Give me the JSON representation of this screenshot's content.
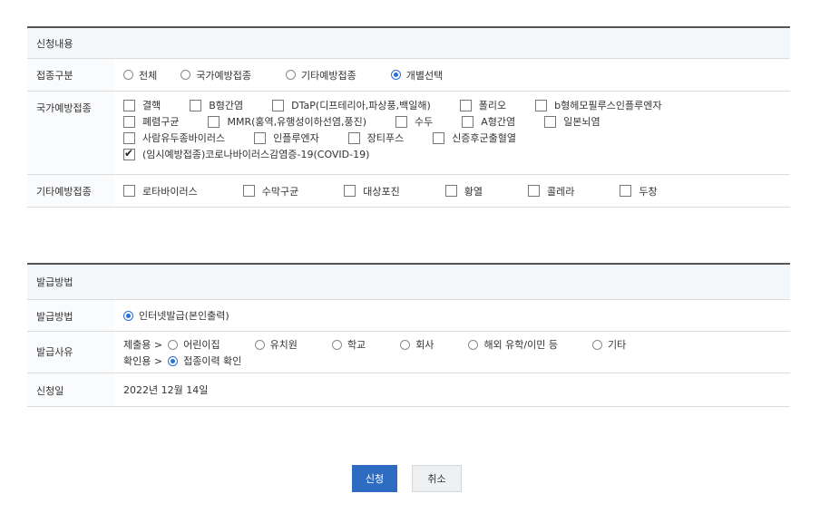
{
  "section1": {
    "title": "신청내용",
    "vaccine_type": {
      "label": "접종구분",
      "options": [
        "전체",
        "국가예방접종",
        "기타예방접종",
        "개별선택"
      ],
      "selected": "개별선택"
    },
    "national": {
      "label": "국가예방접종",
      "items": [
        "결핵",
        "B형간염",
        "DTaP(디프테리아,파상풍,백일해)",
        "폴리오",
        "b형헤모필루스인플루엔자",
        "폐렴구균",
        "MMR(홍역,유행성이하선염,풍진)",
        "수두",
        "A형간염",
        "일본뇌염",
        "사람유두종바이러스",
        "인플루엔자",
        "장티푸스",
        "신증후군출혈열",
        "(임시예방접종)코로나바이러스감염증-19(COVID-19)"
      ],
      "checked": [
        "(임시예방접종)코로나바이러스감염증-19(COVID-19)"
      ]
    },
    "other": {
      "label": "기타예방접종",
      "items": [
        "로타바이러스",
        "수막구균",
        "대상포진",
        "황열",
        "콜레라",
        "두창"
      ]
    }
  },
  "section2": {
    "title": "발급방법",
    "method": {
      "label": "발급방법",
      "option": "인터넷발급(본인출력)"
    },
    "reason": {
      "label": "발급사유",
      "submit_prefix": "제출용 >",
      "submit_options": [
        "어린이집",
        "유치원",
        "학교",
        "회사",
        "해외 유학/이민 등",
        "기타"
      ],
      "confirm_prefix": "확인용 >",
      "confirm_option": "접종이력 확인"
    },
    "date": {
      "label": "신청일",
      "value": "2022년 12월 14일"
    }
  },
  "buttons": {
    "submit": "신청",
    "cancel": "취소"
  },
  "colors": {
    "accent": "#2d6cc0",
    "header_bg": "#f4f7fa"
  }
}
